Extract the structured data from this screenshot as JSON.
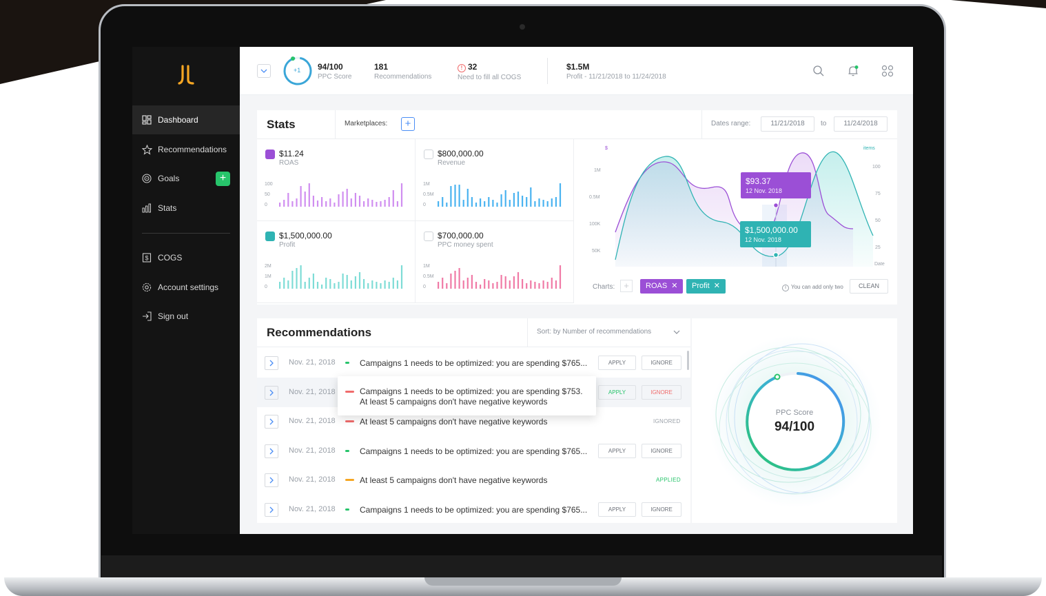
{
  "app": {
    "brand_color": "#f5a623",
    "sidebar": {
      "items": [
        {
          "label": "Dashboard",
          "icon": "dashboard-icon"
        },
        {
          "label": "Recommendations",
          "icon": "star-icon"
        },
        {
          "label": "Goals",
          "icon": "target-icon"
        },
        {
          "label": "Stats",
          "icon": "bar-chart-icon"
        },
        {
          "label": "COGS",
          "icon": "dollar-doc-icon"
        },
        {
          "label": "Account settings",
          "icon": "gear-icon"
        },
        {
          "label": "Sign out",
          "icon": "sign-out-icon"
        }
      ],
      "goals_add": "+"
    },
    "topbar": {
      "score_delta": "+1",
      "score": "94/100",
      "score_label": "PPC Score",
      "reco_count": "181",
      "reco_label": "Recommendations",
      "cogs_count": "32",
      "cogs_label": "Need to fill all COGS",
      "profit": "$1.5M",
      "profit_label": "Profit - 11/21/2018 to 11/24/2018"
    },
    "stats": {
      "title": "Stats",
      "marketplaces_label": "Marketplaces:",
      "add_label": "+",
      "dates_label": "Dates range:",
      "date_from": "11/21/2018",
      "date_to_label": "to",
      "date_to": "11/24/2018",
      "minis": [
        {
          "value": "$11.24",
          "label": "ROAS",
          "checked": true,
          "check_color": "#9b4fd6",
          "bar_color": "#d08ef0",
          "yticks": [
            "100",
            "50",
            "0"
          ]
        },
        {
          "value": "$800,000.00",
          "label": "Revenue",
          "checked": false,
          "check_color": "",
          "bar_color": "#4ab3f0",
          "yticks": [
            "1M",
            "0.5M",
            "0"
          ]
        },
        {
          "value": "$1,500,000.00",
          "label": "Profit",
          "checked": true,
          "check_color": "#2fb3b3",
          "bar_color": "#7edcd6",
          "yticks": [
            "2M",
            "1M",
            "0"
          ]
        },
        {
          "value": "$700,000.00",
          "label": "PPC money spent",
          "checked": false,
          "check_color": "",
          "bar_color": "#f07aa6",
          "yticks": [
            "1M",
            "0.5M",
            "0"
          ]
        }
      ],
      "chart": {
        "y_left_unit": "$",
        "y_left_ticks": [
          "1M",
          "0.5M",
          "100K",
          "50K"
        ],
        "y_right_unit": "items",
        "y_right_ticks": [
          "100",
          "75",
          "50",
          "25"
        ],
        "x_label": "Date",
        "tooltip_roas_value": "$93.37",
        "tooltip_roas_date": "12 Nov. 2018",
        "tooltip_profit_value": "$1,500,000.00",
        "tooltip_profit_date": "12 Nov. 2018",
        "charts_label": "Charts:",
        "chips": [
          {
            "label": "ROAS",
            "color": "#9b4fd6"
          },
          {
            "label": "Profit",
            "color": "#2fb3b3"
          }
        ],
        "add_two_note": "You can add only two",
        "clean_label": "CLEAN"
      }
    },
    "recommendations": {
      "title": "Recommendations",
      "sort_label": "Sort: by Number of recommendations",
      "apply_label": "APPLY",
      "ignore_label": "IGNORE",
      "rows": [
        {
          "date": "Nov. 21, 2018",
          "text": "Campaigns 1 needs to be optimized: you are spending $765...",
          "dash": "#27c46b",
          "status": ""
        },
        {
          "date": "Nov. 21, 2018",
          "text": "",
          "dash": "#f06b6b",
          "status": ""
        },
        {
          "date": "Nov. 21, 2018",
          "text": "At least 5 campaigns don't have negative keywords",
          "dash": "#f06b6b",
          "status": "IGNORED"
        },
        {
          "date": "Nov. 21, 2018",
          "text": "Campaigns 1 needs to be optimized: you are spending $765...",
          "dash": "#27c46b",
          "status": ""
        },
        {
          "date": "Nov. 21, 2018",
          "text": "At least 5 campaigns don't have negative keywords",
          "dash": "#f5a623",
          "status": "APPLIED"
        },
        {
          "date": "Nov. 21, 2018",
          "text": "Campaigns 1 needs to be optimized: you are spending $765...",
          "dash": "#27c46b",
          "status": ""
        }
      ],
      "popup_line1": "Campaigns 1 needs to be optimized: you are spending $753.",
      "popup_line2": "At least 5 campaigns don't have negative keywords"
    },
    "score_card": {
      "label": "PPC Score",
      "value": "94/100"
    }
  }
}
